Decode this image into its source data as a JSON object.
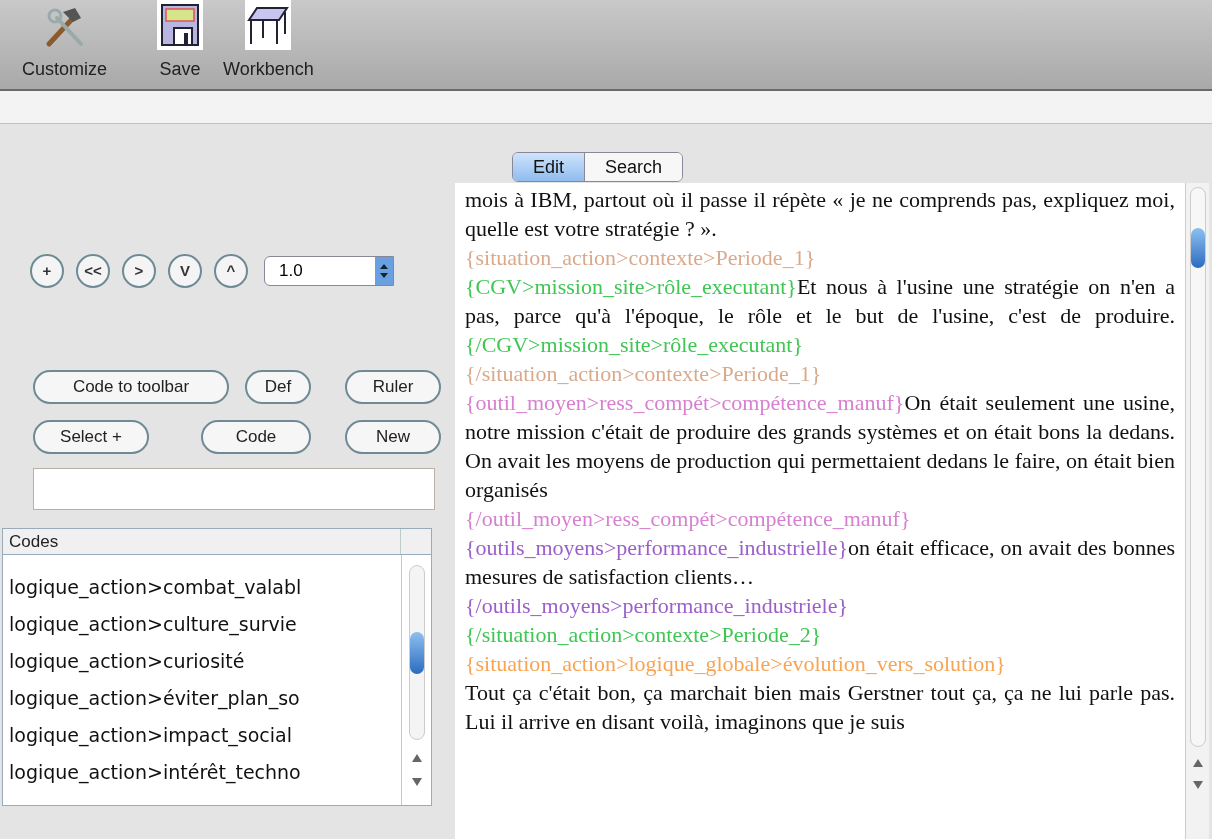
{
  "toolbar": [
    {
      "label": "Customize",
      "kind": "tools"
    },
    {
      "label": "Save",
      "kind": "save"
    },
    {
      "label": "Workbench",
      "kind": "workbench"
    }
  ],
  "tabs": [
    {
      "label": "Edit",
      "selected": true
    },
    {
      "label": "Search",
      "selected": false
    }
  ],
  "nav_buttons": [
    "+",
    "<<",
    ">",
    "V",
    "^"
  ],
  "zoom_select": {
    "value": "1.0"
  },
  "action_buttons": [
    [
      "Code to toolbar",
      "Def",
      "Ruler"
    ],
    [
      "Select +",
      "Code",
      "New"
    ]
  ],
  "codes_list": {
    "header": "Codes",
    "items": [
      "logique_action>combat_valabl",
      "logique_action>culture_survie",
      "logique_action>curiosité",
      "logique_action>éviter_plan_so",
      "logique_action>impact_social",
      "logique_action>intérêt_techno"
    ]
  },
  "document": {
    "paragraphs": [
      [
        {
          "kind": "text",
          "text": "mois à IBM, partout où il passe il répète « je ne comprends pas, expliquez moi, quelle est votre stratégie ? »."
        }
      ],
      [
        {
          "kind": "tag",
          "text": "{situation_action>contexte>Periode_1}",
          "color": "#d9a98c"
        }
      ],
      [
        {
          "kind": "tag",
          "text": "{CGV>mission_site>rôle_executant}",
          "color": "#3fc653"
        },
        {
          "kind": "text",
          "text": "Et nous à l'usine une stratégie on n'en a pas, parce qu'à l'époque, le rôle et le but de l'usine, c'est de produire."
        },
        {
          "kind": "tag",
          "text": "{/CGV>mission_site>rôle_executant}",
          "color": "#3fc653"
        }
      ],
      [
        {
          "kind": "tag",
          "text": "{/situation_action>contexte>Periode_1}",
          "color": "#d9a98c"
        }
      ],
      [
        {
          "kind": "tag",
          "text": "{outil_moyen>ress_compét>compétence_manuf}",
          "color": "#d77fd0"
        },
        {
          "kind": "text",
          "text": "On était seulement une usine, notre mission c'était de produire des grands systèmes et on était bons la dedans. On avait les moyens de production qui permettaient dedans le faire, on était bien organisés"
        }
      ],
      [
        {
          "kind": "tag",
          "text": "{/outil_moyen>ress_compét>compétence_manuf}",
          "color": "#d77fd0"
        }
      ],
      [
        {
          "kind": "tag",
          "text": "{outils_moyens>performance_industrielle}",
          "color": "#9b5fc9"
        },
        {
          "kind": "text",
          "text": "on était efficace, on avait des bonnes mesures de satisfaction clients…"
        }
      ],
      [
        {
          "kind": "tag",
          "text": "{/outils_moyens>performance_industriele}",
          "color": "#9b5fc9"
        }
      ],
      [
        {
          "kind": "tag",
          "text": "{/situation_action>contexte>Periode_2}",
          "color": "#3fc653"
        }
      ],
      [
        {
          "kind": "tag",
          "text": "{situation_action>logique_globale>évolution_vers_solution}",
          "color": "#f7a453"
        }
      ],
      [
        {
          "kind": "text",
          "text": "Tout ça c'était bon, ça marchait bien mais Gerstner tout ça, ça ne lui parle pas. Lui il arrive en disant voilà, imaginons que je suis"
        }
      ]
    ]
  }
}
